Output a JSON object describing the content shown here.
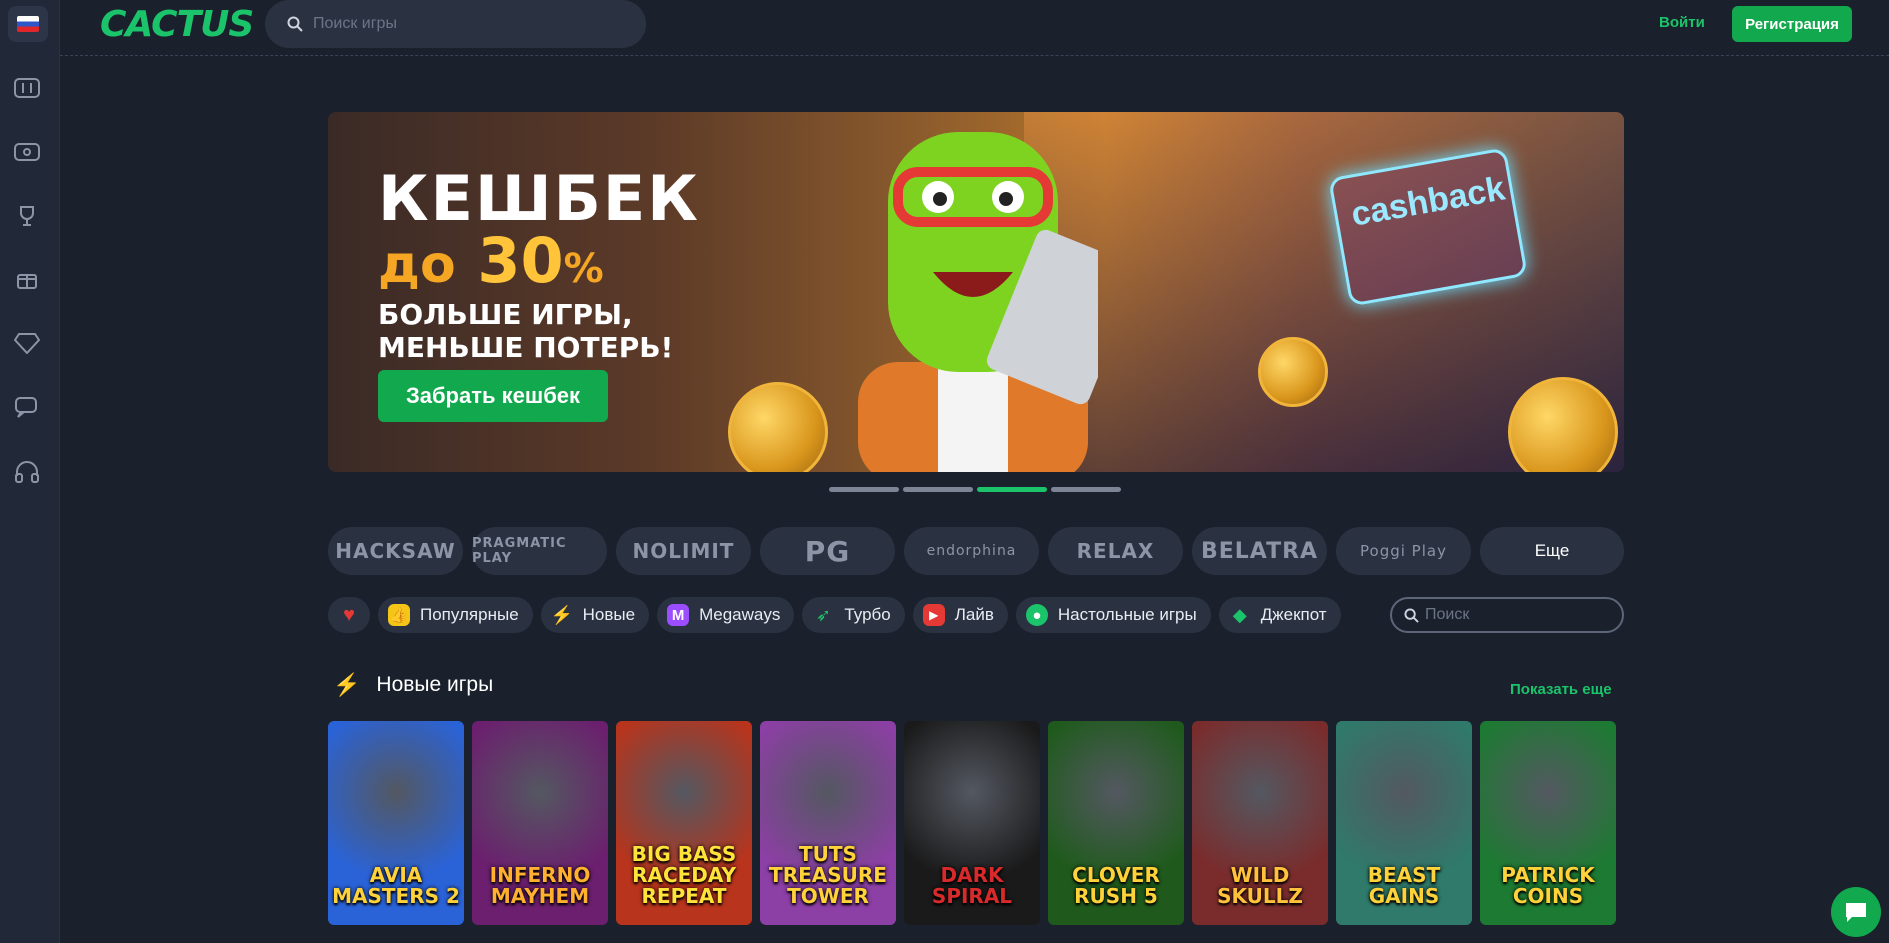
{
  "header": {
    "logo": "CACTUS",
    "search_placeholder": "Поиск игры",
    "login": "Войти",
    "register": "Регистрация"
  },
  "sidebar": {
    "items": [
      {
        "icon": "slot-machine-icon"
      },
      {
        "icon": "ticket-icon"
      },
      {
        "icon": "trophy-icon"
      },
      {
        "icon": "gift-icon"
      },
      {
        "icon": "diamond-icon"
      },
      {
        "icon": "chat-bubbles-icon"
      },
      {
        "icon": "headset-icon"
      }
    ]
  },
  "banner": {
    "line1": "КЕШБЕК",
    "line2_prefix": "до",
    "line2_value": "30",
    "line2_suffix": "%",
    "line3": "БОЛЬШЕ ИГРЫ, МЕНЬШЕ ПОТЕРЬ!",
    "cta": "Забрать кешбек",
    "card_text": "cashback",
    "active_slide": 3,
    "slides": 4
  },
  "providers": {
    "items": [
      "HACKSAW",
      "PRAGMATIC PLAY",
      "NOLIMIT",
      "PG",
      "endorphina",
      "RELAX",
      "BELATRA",
      "Poggi Play"
    ],
    "more": "Еще"
  },
  "categories": {
    "items": [
      {
        "label": "",
        "icon": "heart-icon",
        "color": "#e53935"
      },
      {
        "label": "Популярные",
        "icon": "thumbs-up-icon",
        "color": "#f5c518"
      },
      {
        "label": "Новые",
        "icon": "lightning-icon",
        "color": "#c03cff"
      },
      {
        "label": "Megaways",
        "icon": "megaways-icon",
        "color": "#9c4dff"
      },
      {
        "label": "Турбо",
        "icon": "rocket-icon",
        "color": "#1bc46a"
      },
      {
        "label": "Лайв",
        "icon": "live-camera-icon",
        "color": "#e53935"
      },
      {
        "label": "Настольные игры",
        "icon": "table-games-icon",
        "color": "#1bc46a"
      },
      {
        "label": "Джекпот",
        "icon": "gem-icon",
        "color": "#1bc46a"
      }
    ],
    "search_placeholder": "Поиск"
  },
  "new_games": {
    "title": "Новые игры",
    "show_more": "Показать еще",
    "games": [
      {
        "title": "AVIA MASTERS 2",
        "bg": "#2a63d8",
        "fg": "#ffd23a"
      },
      {
        "title": "INFERNO MAYHEM",
        "bg": "#6b1f6e",
        "fg": "#ffb02e"
      },
      {
        "title": "BIG BASS RACEDAY REPEAT",
        "bg": "#b8341c",
        "fg": "#ffe23a"
      },
      {
        "title": "TUTS TREASURE TOWER",
        "bg": "#8c3fa4",
        "fg": "#ffd23a"
      },
      {
        "title": "DARK SPIRAL",
        "bg": "#1a1a1a",
        "fg": "#d82a2a"
      },
      {
        "title": "CLOVER RUSH 5",
        "bg": "#1f5a1c",
        "fg": "#ffd23a"
      },
      {
        "title": "WILD SKULLZ",
        "bg": "#7a2c2c",
        "fg": "#ffc23a"
      },
      {
        "title": "BEAST GAINS",
        "bg": "#2f7a6a",
        "fg": "#ffd23a"
      },
      {
        "title": "PATRICK COINS",
        "bg": "#1d7a32",
        "fg": "#ffd23a"
      }
    ]
  }
}
